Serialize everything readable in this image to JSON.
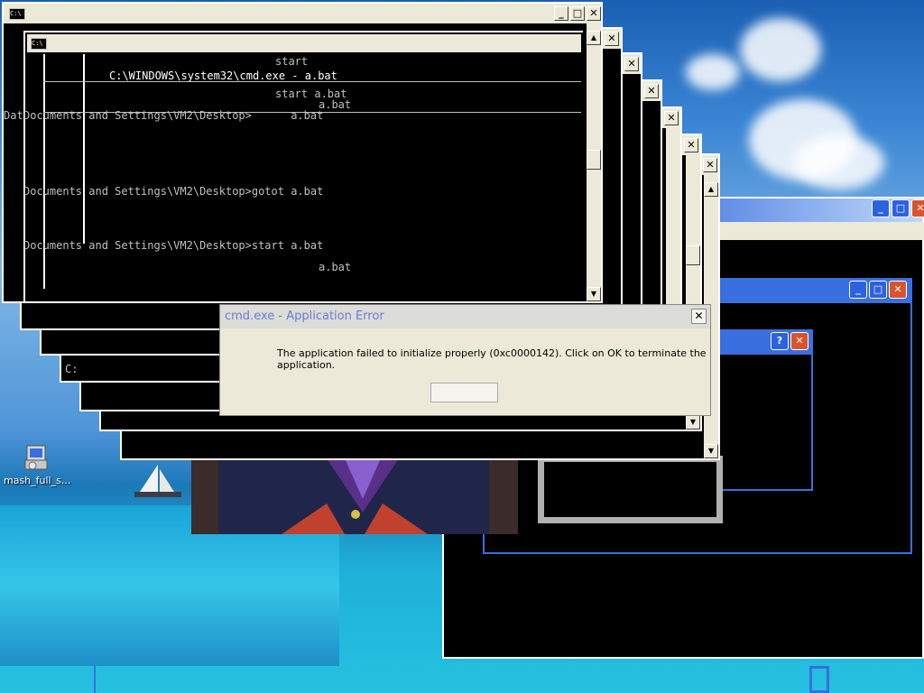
{
  "desktop": {
    "icon_label": "mash_full_s..."
  },
  "cmd_windows": {
    "main_title_icon": "C:\\",
    "prompt_lines": [
      "start",
      "C:\\WINDOWS\\system32\\cmd.exe - a.bat",
      "start a.bat",
      "a.bat",
      "Documents and Settings\\VM2\\Desktop>      a.bat",
      "Documents and Settings\\VM2\\Desktop>gotot a.bat",
      "Documents and Settings\\VM2\\Desktop>start a.bat",
      "a.bat"
    ],
    "fragment_dat": "Dat",
    "fragment_c": "C:"
  },
  "dialog": {
    "title": "cmd.exe - Application Error",
    "message": "The application failed to initialize properly (0xc0000142). Click on OK to terminate the application.",
    "ok_label": "",
    "close_glyph": "✕"
  },
  "window_buttons": {
    "minimize": "_",
    "maximize": "□",
    "close": "✕",
    "help": "?"
  },
  "colors": {
    "xp_blue": "#3a6fe0",
    "dialog_bg": "#ece9d8",
    "dialog_title": "#6b7bd6"
  }
}
